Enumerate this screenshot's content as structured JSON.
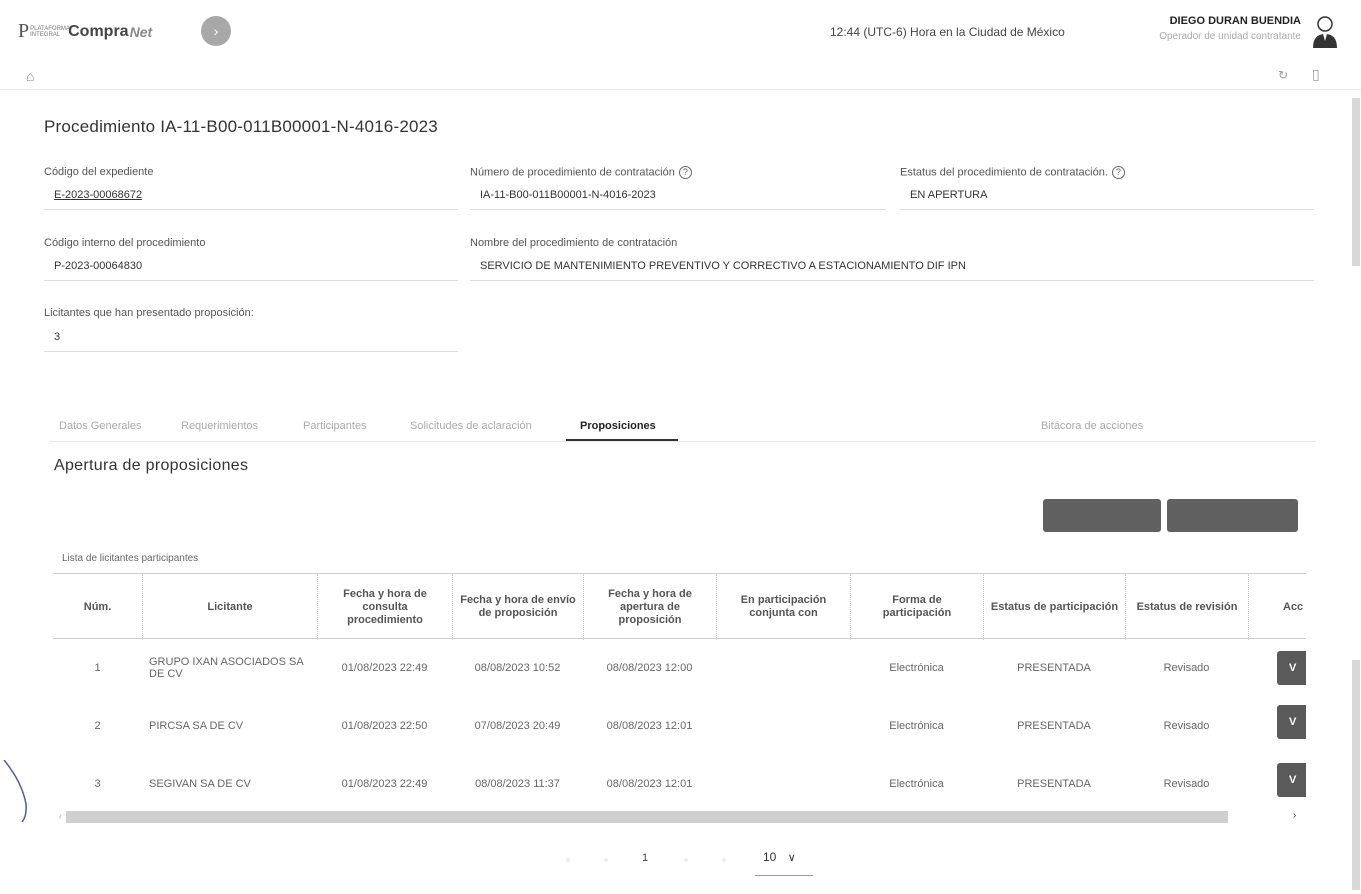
{
  "header": {
    "logo_p": "P",
    "logo_small": "PLATAFORMA INTEGRAL",
    "logo_brand": "Compra",
    "logo_net": "Net",
    "next_arrow": "›",
    "clock": "12:44 (UTC-6) Hora en la Ciudad de México",
    "user_name": "DIEGO DURAN BUENDIA",
    "user_role": "Operador de unidad contratante"
  },
  "procedure": {
    "title": "Procedimiento IA-11-B00-011B00001-N-4016-2023",
    "fields": {
      "codigo_expediente": {
        "label": "Código del expediente",
        "value": "E-2023-00068672"
      },
      "numero_procedimiento": {
        "label": "Número de procedimiento de contratación",
        "value": "IA-11-B00-011B00001-N-4016-2023"
      },
      "estatus": {
        "label": "Estatus del procedimiento de contratación.",
        "value": "EN APERTURA"
      },
      "codigo_interno": {
        "label": "Código interno del procedimiento",
        "value": "P-2023-00064830"
      },
      "nombre": {
        "label": "Nombre del procedimiento de contratación",
        "value": "SERVICIO DE MANTENIMIENTO PREVENTIVO Y CORRECTIVO A ESTACIONAMIENTO DIF IPN"
      },
      "licitantes": {
        "label": "Licitantes que han presentado proposición:",
        "value": "3"
      }
    },
    "help_glyph": "?"
  },
  "tabs": [
    {
      "label": "Datos Generales"
    },
    {
      "label": "Requerimientos"
    },
    {
      "label": "Participantes"
    },
    {
      "label": "Solicitudes de aclaración"
    },
    {
      "label": "Proposiciones",
      "active": true
    },
    {
      "label": "Bitácora de acciones"
    }
  ],
  "section": {
    "title": "Apertura de proposiciones",
    "list_label": "Lista de licitantes participantes"
  },
  "table": {
    "headers": [
      "Núm.",
      "Licitante",
      "Fecha y hora de consulta procedimiento",
      "Fecha y hora de envío de proposición",
      "Fecha y hora de apertura de proposición",
      "En participación conjunta con",
      "Forma de participación",
      "Estatus de participación",
      "Estatus de revisión",
      "Acc"
    ],
    "rows": [
      {
        "num": "1",
        "licitante": "GRUPO IXAN ASOCIADOS SA DE CV",
        "consulta": "01/08/2023 22:49",
        "envio": "08/08/2023 10:52",
        "apertura": "08/08/2023 12:00",
        "conjunta": "",
        "forma": "Electrónica",
        "estatus_part": "PRESENTADA",
        "estatus_rev": "Revisado",
        "accion": "V"
      },
      {
        "num": "2",
        "licitante": "PIRCSA SA DE CV",
        "consulta": "01/08/2023 22:50",
        "envio": "07/08/2023 20:49",
        "apertura": "08/08/2023 12:01",
        "conjunta": "",
        "forma": "Electrónica",
        "estatus_part": "PRESENTADA",
        "estatus_rev": "Revisado",
        "accion": "V"
      },
      {
        "num": "3",
        "licitante": "SEGIVAN SA DE CV",
        "consulta": "01/08/2023 22:49",
        "envio": "08/08/2023 11:37",
        "apertura": "08/08/2023 12:01",
        "conjunta": "",
        "forma": "Electrónica",
        "estatus_part": "PRESENTADA",
        "estatus_rev": "Revisado",
        "accion": "V"
      }
    ]
  },
  "pagination": {
    "page": "1",
    "page_size": "10",
    "chevron": "∨"
  },
  "icons": {
    "home": "⌂",
    "refresh": "↻",
    "bookmark": "▯",
    "scroll_left": "‹",
    "scroll_right": "›"
  }
}
